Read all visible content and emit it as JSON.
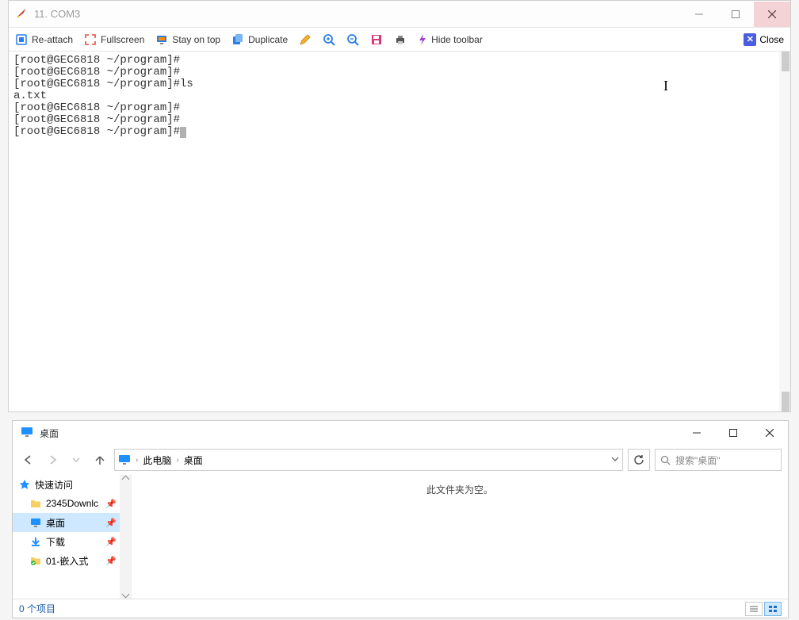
{
  "top_window": {
    "title": "11. COM3",
    "toolbar": {
      "reattach": "Re-attach",
      "fullscreen": "Fullscreen",
      "stay_on_top": "Stay on top",
      "duplicate": "Duplicate",
      "hide_toolbar": "Hide toolbar",
      "close": "Close"
    },
    "terminal_lines": [
      "[root@GEC6818 ~/program]#",
      "[root@GEC6818 ~/program]#",
      "[root@GEC6818 ~/program]#ls",
      "a.txt",
      "[root@GEC6818 ~/program]#",
      "[root@GEC6818 ~/program]#",
      "[root@GEC6818 ~/program]#"
    ]
  },
  "explorer": {
    "title": "桌面",
    "breadcrumb": {
      "seg1": "此电脑",
      "seg2": "桌面"
    },
    "search_placeholder": "搜索\"桌面\"",
    "sidebar": {
      "header": "快速访问",
      "items": [
        {
          "label": "2345Downlc",
          "icon": "folder",
          "pinned": true
        },
        {
          "label": "桌面",
          "icon": "monitor",
          "pinned": true,
          "selected": true
        },
        {
          "label": "下载",
          "icon": "download",
          "pinned": true
        },
        {
          "label": "01-嵌入式",
          "icon": "folder-check",
          "pinned": true
        }
      ]
    },
    "empty_text": "此文件夹为空。",
    "status": "0 个项目"
  }
}
